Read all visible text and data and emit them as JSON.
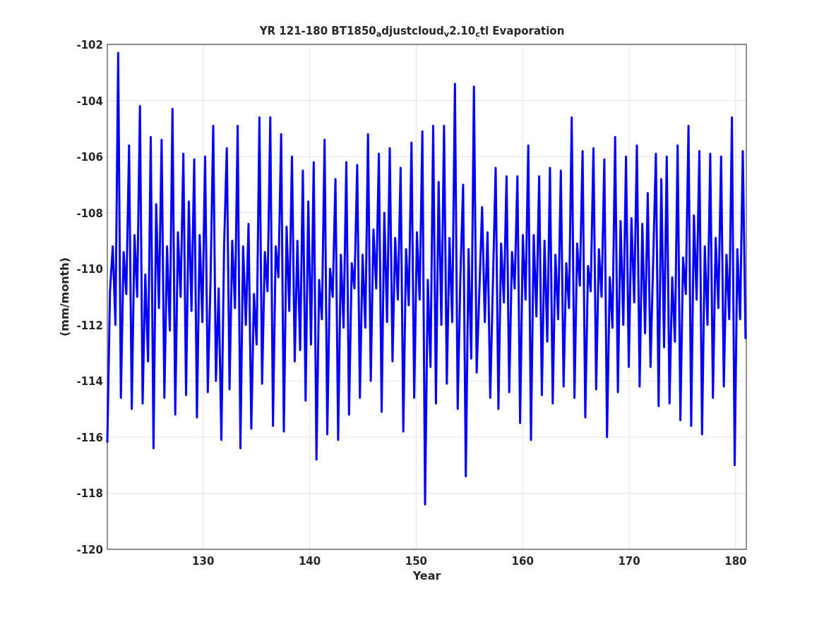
{
  "figure": {
    "chart_data": {
      "type": "line",
      "title": "YR 121-180 BT1850$_{a}$djustcloud$_{v}$2.10$_{c}$tl Evaporation",
      "xlabel": "Year",
      "ylabel": "(mm/month)",
      "grid": true,
      "xlim": [
        121,
        181
      ],
      "x": [
        121,
        121.255,
        121.51,
        121.765,
        122.02,
        122.275,
        122.53,
        122.785,
        123.04,
        123.295,
        123.55,
        123.805,
        124.06,
        124.315,
        124.57,
        124.825,
        125.08,
        125.335,
        125.59,
        125.845,
        126.1,
        126.355,
        126.61,
        126.865,
        127.12,
        127.375,
        127.63,
        127.885,
        128.14,
        128.395,
        128.65,
        128.905,
        129.16,
        129.415,
        129.67,
        129.925,
        130.18,
        130.435,
        130.69,
        130.945,
        131.2,
        131.455,
        131.71,
        131.965,
        132.22,
        132.475,
        132.73,
        132.985,
        133.24,
        133.495,
        133.75,
        134.005,
        134.26,
        134.515,
        134.77,
        135.025,
        135.28,
        135.535,
        135.79,
        136.045,
        136.3,
        136.555,
        136.81,
        137.065,
        137.32,
        137.575,
        137.83,
        138.085,
        138.34,
        138.595,
        138.85,
        139.105,
        139.36,
        139.615,
        139.87,
        140.125,
        140.38,
        140.635,
        140.89,
        141.145,
        141.4,
        141.655,
        141.91,
        142.165,
        142.42,
        142.675,
        142.93,
        143.185,
        143.44,
        143.695,
        143.95,
        144.205,
        144.46,
        144.715,
        144.97,
        145.225,
        145.48,
        145.735,
        145.99,
        146.245,
        146.5,
        146.755,
        147.01,
        147.265,
        147.52,
        147.775,
        148.03,
        148.285,
        148.54,
        148.795,
        149.05,
        149.305,
        149.56,
        149.815,
        150.07,
        150.325,
        150.58,
        150.835,
        151.09,
        151.345,
        151.6,
        151.855,
        152.11,
        152.365,
        152.62,
        152.875,
        153.13,
        153.385,
        153.64,
        153.895,
        154.15,
        154.405,
        154.66,
        154.915,
        155.17,
        155.425,
        155.68,
        155.935,
        156.19,
        156.445,
        156.7,
        156.955,
        157.21,
        157.465,
        157.72,
        157.975,
        158.23,
        158.485,
        158.74,
        158.995,
        159.25,
        159.505,
        159.76,
        160.015,
        160.27,
        160.525,
        160.78,
        161.035,
        161.29,
        161.545,
        161.8,
        162.055,
        162.31,
        162.565,
        162.82,
        163.075,
        163.33,
        163.585,
        163.84,
        164.095,
        164.35,
        164.605,
        164.86,
        165.115,
        165.37,
        165.625,
        165.88,
        166.135,
        166.39,
        166.645,
        166.9,
        167.155,
        167.41,
        167.665,
        167.92,
        168.175,
        168.43,
        168.685,
        168.94,
        169.195,
        169.45,
        169.705,
        169.96,
        170.215,
        170.47,
        170.725,
        170.98,
        171.235,
        171.49,
        171.745,
        172,
        172.255,
        172.51,
        172.765,
        173.02,
        173.275,
        173.53,
        173.785,
        174.04,
        174.295,
        174.55,
        174.805,
        175.06,
        175.315,
        175.57,
        175.825,
        176.08,
        176.335,
        176.59,
        176.845,
        177.1,
        177.355,
        177.61,
        177.865,
        178.12,
        178.375,
        178.63,
        178.885,
        179.14,
        179.395,
        179.65,
        179.905,
        180.16,
        180.415,
        180.67,
        180.925
      ],
      "ylim": [
        -120,
        -102
      ],
      "xticks": [
        130,
        140,
        150,
        160,
        170,
        180
      ],
      "yticks": [
        -120,
        -118,
        -116,
        -114,
        -112,
        -110,
        -108,
        -106,
        -104,
        -102
      ],
      "series": [
        {
          "color": "#0000ff",
          "values": [
            -116.2,
            -110.8,
            -109.2,
            -112,
            -102.3,
            -114.6,
            -109.4,
            -110.9,
            -105.6,
            -115,
            -108.8,
            -111,
            -104.2,
            -114.8,
            -110.2,
            -113.3,
            -105.3,
            -116.4,
            -107.7,
            -111.4,
            -105.4,
            -114.6,
            -109.2,
            -112.2,
            -104.3,
            -115.2,
            -108.7,
            -111,
            -105.9,
            -114.5,
            -107.6,
            -111.5,
            -106.1,
            -115.3,
            -108.8,
            -111.9,
            -106,
            -114.4,
            -110.4,
            -104.9,
            -114,
            -110.7,
            -116.1,
            -109.2,
            -105.7,
            -114.3,
            -109,
            -111.4,
            -104.9,
            -116.4,
            -109.2,
            -112,
            -108.4,
            -115.7,
            -110.9,
            -112.7,
            -104.6,
            -114.1,
            -109.4,
            -110.8,
            -104.6,
            -115.6,
            -109.2,
            -110.3,
            -105.2,
            -115.8,
            -108.5,
            -111.5,
            -106,
            -113.3,
            -109,
            -112.9,
            -106.5,
            -114.7,
            -107.6,
            -112.7,
            -106.2,
            -116.8,
            -110.4,
            -111.8,
            -105.4,
            -115.9,
            -110,
            -111,
            -106.8,
            -116.1,
            -109.5,
            -112.1,
            -106.2,
            -115.2,
            -109.8,
            -110.7,
            -106.3,
            -114.6,
            -109.5,
            -112.1,
            -105.2,
            -114,
            -108.6,
            -110.7,
            -105.9,
            -115.1,
            -108,
            -111.9,
            -105.7,
            -113.3,
            -108.9,
            -111.1,
            -106.4,
            -115.8,
            -109.3,
            -111.3,
            -105.5,
            -114.6,
            -108.7,
            -111.1,
            -105.1,
            -118.4,
            -110.4,
            -113.5,
            -104.9,
            -114.8,
            -106.9,
            -112,
            -104.9,
            -114.1,
            -108.9,
            -111.9,
            -103.4,
            -115,
            -110.3,
            -107,
            -117.4,
            -109.3,
            -113.2,
            -103.5,
            -113.7,
            -110.8,
            -107.8,
            -111.9,
            -108.7,
            -114.6,
            -110.4,
            -106.4,
            -115,
            -109.1,
            -111.2,
            -106.7,
            -114.4,
            -109.4,
            -110.7,
            -106.7,
            -115.5,
            -108.8,
            -111.1,
            -105.6,
            -116.1,
            -108.8,
            -111.7,
            -106.7,
            -114.5,
            -109,
            -112.6,
            -106.4,
            -114.8,
            -109.5,
            -111.8,
            -106.5,
            -114.2,
            -109.8,
            -111.4,
            -104.6,
            -114.6,
            -109.1,
            -110.6,
            -105.8,
            -115.3,
            -109.9,
            -110.8,
            -105.7,
            -114.3,
            -109.3,
            -111,
            -106.1,
            -116,
            -110.3,
            -112.1,
            -105.3,
            -114.4,
            -108.3,
            -112,
            -106,
            -113.5,
            -108.2,
            -111.2,
            -105.6,
            -114.2,
            -108.4,
            -112.3,
            -107.3,
            -113.5,
            -109.7,
            -105.9,
            -114.9,
            -106.8,
            -112.8,
            -106,
            -114.8,
            -110.3,
            -112.6,
            -105.6,
            -115.4,
            -109.6,
            -110.9,
            -104.9,
            -115.6,
            -108.1,
            -111.1,
            -105.8,
            -115.9,
            -109.2,
            -112,
            -105.9,
            -114.6,
            -108.9,
            -111.4,
            -106,
            -114.2,
            -109.5,
            -111.8,
            -104.6,
            -117,
            -109.3,
            -111.8,
            -105.8,
            -112.5
          ]
        }
      ]
    }
  }
}
